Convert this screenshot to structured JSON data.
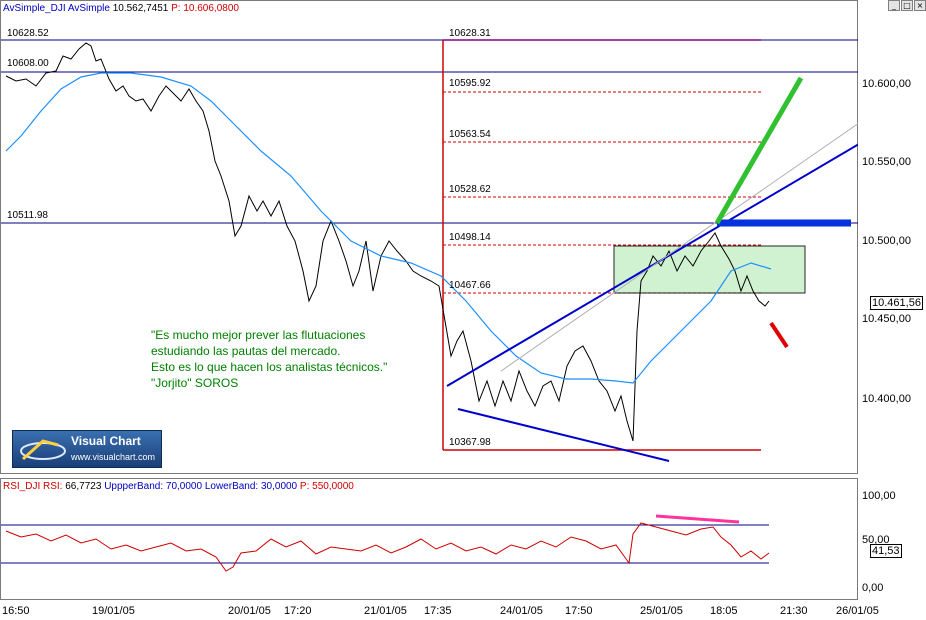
{
  "main": {
    "header": {
      "indicator": "AvSimple_DJI",
      "series": "AvSimple",
      "value": "10.562,7451",
      "param": "P: 10.606,0800"
    },
    "levels": [
      "10628.52",
      "10608.00",
      "10511.98",
      "10628.31",
      "10595.92",
      "10563.54",
      "10528.62",
      "10498.14",
      "10467.66",
      "10367.98"
    ],
    "quote": "\"Es mucho mejor prever las flutuaciones\nestudiando las pautas del mercado.\nEsto es lo que hacen los analistas técnicos.\"\n\"Jorjito\" SOROS",
    "logo": {
      "name": "Visual Chart",
      "url": "www.visualchart.com"
    }
  },
  "price_axis": {
    "ticks": [
      "10.600,00",
      "10.550,00",
      "10.500,00",
      "10.450,00",
      "10.400,00"
    ],
    "current": "10.461,56"
  },
  "rsi": {
    "header": {
      "indicator": "RSI_DJI",
      "series": "RSI:",
      "value": "66,7723",
      "upper": "UppperBand: 70,0000",
      "lower": "LowerBand: 30,0000",
      "param": "P: 550,0000"
    },
    "ticks": [
      "100,00",
      "50,00",
      "0,00"
    ],
    "current": "41,53"
  },
  "time_axis": [
    "16:50",
    "19/01/05",
    "20/01/05",
    "17:20",
    "21/01/05",
    "17:35",
    "24/01/05",
    "17:50",
    "25/01/05",
    "18:05",
    "21:30",
    "26/01/05"
  ],
  "colors": {
    "price": "#000000",
    "ma": "#1e90ff",
    "band": "#000080",
    "trend": "#0000cc",
    "fib": "#d00000",
    "box": "#c8f0c8",
    "green": "#30c030",
    "rsi": "#cc0000",
    "magenta": "#ff3399"
  }
}
